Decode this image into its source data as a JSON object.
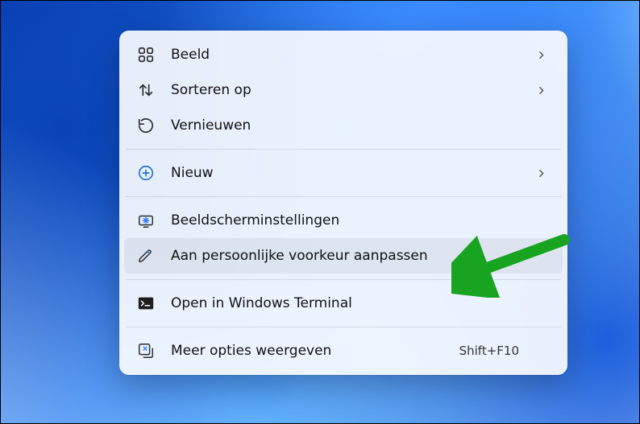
{
  "menu": {
    "groups": [
      [
        {
          "id": "view",
          "label": "Beeld",
          "icon": "grid-icon",
          "submenu": true
        },
        {
          "id": "sort",
          "label": "Sorteren op",
          "icon": "sort-icon",
          "submenu": true
        },
        {
          "id": "refresh",
          "label": "Vernieuwen",
          "icon": "refresh-icon",
          "submenu": false
        }
      ],
      [
        {
          "id": "new",
          "label": "Nieuw",
          "icon": "new-icon",
          "submenu": true
        }
      ],
      [
        {
          "id": "display",
          "label": "Beeldscherminstellingen",
          "icon": "display-settings-icon",
          "submenu": false
        },
        {
          "id": "personal",
          "label": "Aan persoonlijke voorkeur aanpassen",
          "icon": "personalize-icon",
          "submenu": false,
          "highlight": true
        }
      ],
      [
        {
          "id": "terminal",
          "label": "Open in Windows Terminal",
          "icon": "terminal-icon",
          "submenu": false
        }
      ],
      [
        {
          "id": "more",
          "label": "Meer opties weergeven",
          "icon": "more-options-icon",
          "submenu": false,
          "shortcut": "Shift+F10"
        }
      ]
    ]
  },
  "annotation": {
    "arrow_points_to": "personal",
    "arrow_color": "#18a321"
  }
}
